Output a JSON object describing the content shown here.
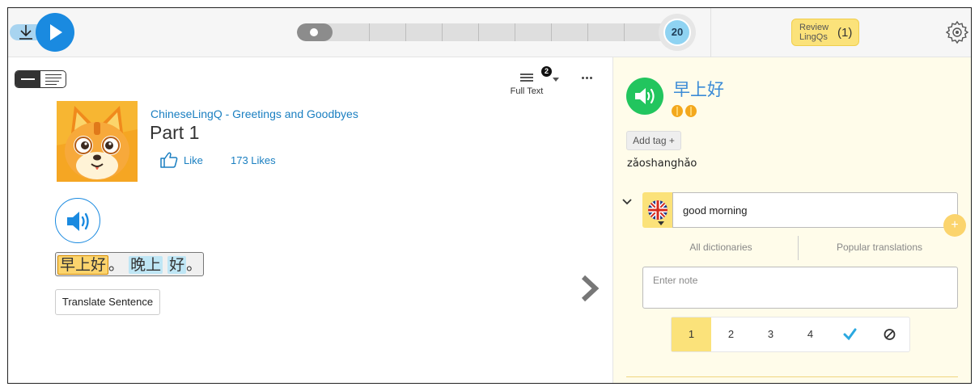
{
  "topbar": {
    "progress_count": "20",
    "review": {
      "label": "Review LingQs",
      "count": "(1)"
    }
  },
  "reader": {
    "view_mode": {
      "label": "Full Text",
      "badge": "2"
    },
    "course_title": "ChineseLingQ - Greetings and Goodbyes",
    "lesson_title": "Part 1",
    "like_label": "Like",
    "likes_count": "173 Likes",
    "sentence": {
      "words": [
        "早上好",
        "晚上",
        "好"
      ],
      "punct": [
        "。",
        "。"
      ]
    },
    "translate_label": "Translate Sentence"
  },
  "panel": {
    "term": "早上好",
    "add_tag": "Add tag +",
    "pinyin": "zǎoshanghǎo",
    "hint": {
      "value": "good morning",
      "add": "+"
    },
    "dictionaries": [
      "All dictionaries",
      "Popular translations"
    ],
    "note_placeholder": "Enter note",
    "status_levels": [
      "1",
      "2",
      "3",
      "4"
    ],
    "active_status": "1"
  },
  "colors": {
    "accent_blue": "#1a8ae0",
    "link_blue": "#1a7fc1",
    "lingq_yellow": "#fbd46d",
    "known_blue": "#bfe6f5",
    "audio_green": "#22c55e",
    "panel_bg": "#fffcea"
  },
  "icons": {
    "download": "download-icon",
    "play": "play-icon",
    "settings": "gear-icon",
    "like": "thumbs-up-icon",
    "audio": "speaker-icon",
    "next": "chevron-right-icon",
    "language": "uk-flag-icon",
    "known": "checkmark-icon",
    "ignore": "ignore-icon"
  }
}
